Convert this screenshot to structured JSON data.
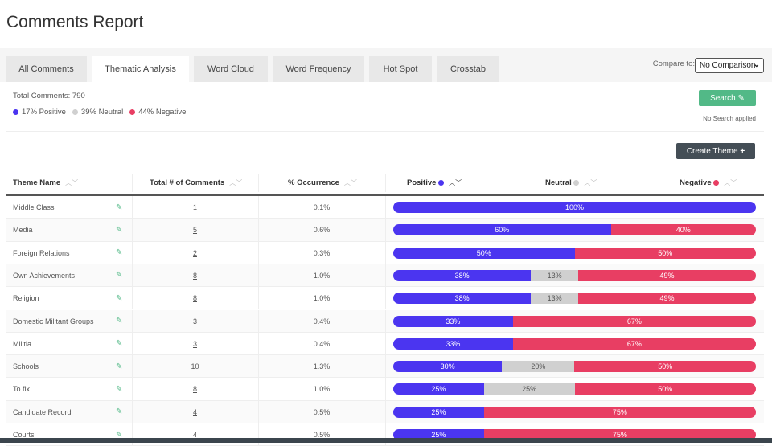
{
  "title": "Comments Report",
  "tabs": [
    {
      "label": "All Comments"
    },
    {
      "label": "Thematic Analysis",
      "active": true
    },
    {
      "label": "Word Cloud"
    },
    {
      "label": "Word Frequency"
    },
    {
      "label": "Hot Spot"
    },
    {
      "label": "Crosstab"
    }
  ],
  "compare": {
    "label": "Compare to:",
    "value": "No Comparison"
  },
  "summary": {
    "total": "Total Comments: 790",
    "positive": "17% Positive",
    "neutral": "39% Neutral",
    "negative": "44% Negative"
  },
  "search": {
    "label": "Search",
    "status": "No Search applied"
  },
  "create_theme": "Create Theme",
  "colors": {
    "positive": "#4b35f0",
    "neutral": "#d0d0d0",
    "negative": "#e83e63",
    "search": "#52b987",
    "create": "#444e56"
  },
  "columns": {
    "name": "Theme Name",
    "total": "Total # of Comments",
    "occurrence": "% Occurrence",
    "positive": "Positive",
    "neutral": "Neutral",
    "negative": "Negative"
  },
  "rows": [
    {
      "name": "Middle Class",
      "total": "1",
      "occ": "0.1%",
      "pos": 100,
      "neu": 0,
      "neg": 0
    },
    {
      "name": "Media",
      "total": "5",
      "occ": "0.6%",
      "pos": 60,
      "neu": 0,
      "neg": 40
    },
    {
      "name": "Foreign Relations",
      "total": "2",
      "occ": "0.3%",
      "pos": 50,
      "neu": 0,
      "neg": 50
    },
    {
      "name": "Own Achievements",
      "total": "8",
      "occ": "1.0%",
      "pos": 38,
      "neu": 13,
      "neg": 49
    },
    {
      "name": "Religion",
      "total": "8",
      "occ": "1.0%",
      "pos": 38,
      "neu": 13,
      "neg": 49
    },
    {
      "name": "Domestic Militant Groups",
      "total": "3",
      "occ": "0.4%",
      "pos": 33,
      "neu": 0,
      "neg": 67
    },
    {
      "name": "Militia",
      "total": "3",
      "occ": "0.4%",
      "pos": 33,
      "neu": 0,
      "neg": 67
    },
    {
      "name": "Schools",
      "total": "10",
      "occ": "1.3%",
      "pos": 30,
      "neu": 20,
      "neg": 50
    },
    {
      "name": "To fix",
      "total": "8",
      "occ": "1.0%",
      "pos": 25,
      "neu": 25,
      "neg": 50
    },
    {
      "name": "Candidate Record",
      "total": "4",
      "occ": "0.5%",
      "pos": 25,
      "neu": 0,
      "neg": 75
    },
    {
      "name": "Courts",
      "total": "4",
      "occ": "0.5%",
      "pos": 25,
      "neu": 0,
      "neg": 75
    }
  ]
}
